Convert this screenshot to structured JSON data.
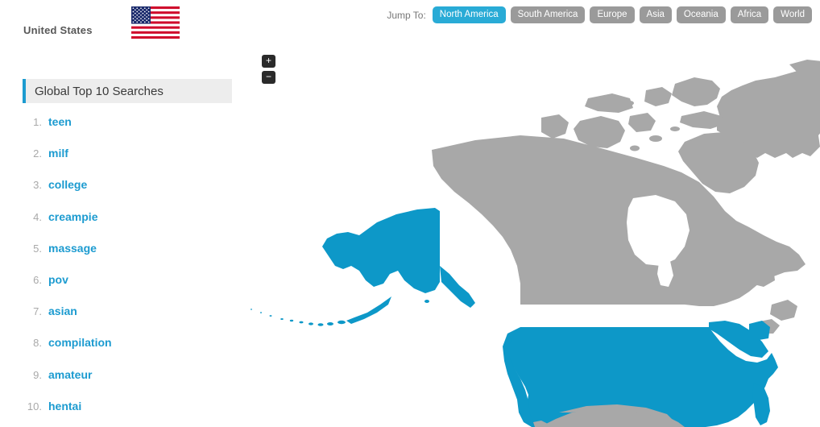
{
  "panel": {
    "country_name": "United States",
    "flag_icon": "us-flag-icon",
    "list_title": "Global Top 10 Searches",
    "searches": [
      {
        "rank": "1.",
        "term": "teen"
      },
      {
        "rank": "2.",
        "term": "milf"
      },
      {
        "rank": "3.",
        "term": "college"
      },
      {
        "rank": "4.",
        "term": "creampie"
      },
      {
        "rank": "5.",
        "term": "massage"
      },
      {
        "rank": "6.",
        "term": "pov"
      },
      {
        "rank": "7.",
        "term": "asian"
      },
      {
        "rank": "8.",
        "term": "compilation"
      },
      {
        "rank": "9.",
        "term": "amateur"
      },
      {
        "rank": "10.",
        "term": "hentai"
      }
    ]
  },
  "jump_to": {
    "label": "Jump To:",
    "buttons": [
      {
        "label": "North America",
        "active": true
      },
      {
        "label": "South America",
        "active": false
      },
      {
        "label": "Europe",
        "active": false
      },
      {
        "label": "Asia",
        "active": false
      },
      {
        "label": "Oceania",
        "active": false
      },
      {
        "label": "Africa",
        "active": false
      },
      {
        "label": "World",
        "active": false
      }
    ]
  },
  "map": {
    "region": "North America",
    "zoom_in_label": "+",
    "zoom_out_label": "−",
    "highlighted_country": "United States",
    "colors": {
      "highlight": "#0d98c8",
      "land": "#a8a8a8",
      "ocean": "#ffffff",
      "accent": "#1c9bd0",
      "active_button": "#29abd6",
      "inactive_button": "#9a9a9a"
    }
  }
}
